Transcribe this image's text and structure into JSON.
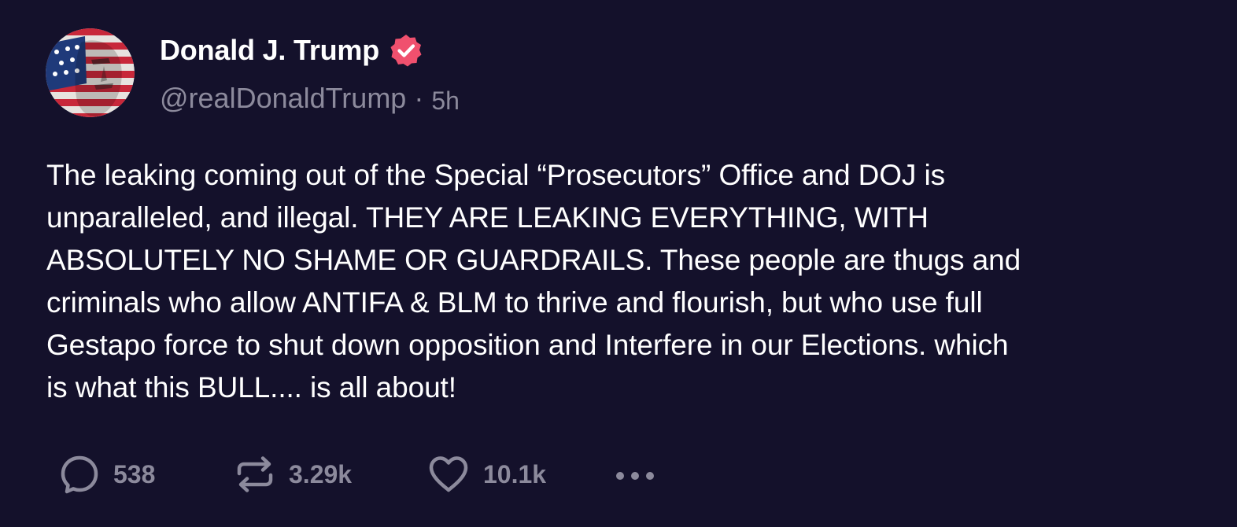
{
  "author": {
    "display_name": "Donald J. Trump",
    "handle": "@realDonaldTrump",
    "separator": "·",
    "time_ago": "5h",
    "verified_icon": "verified-badge-icon",
    "verified_color": "#f0506e",
    "avatar_icon": "profile-avatar"
  },
  "post": {
    "text": "The leaking coming out of the Special “Prosecutors” Office and DOJ is\nunparalleled, and illegal. THEY ARE LEAKING EVERYTHING, WITH\nABSOLUTELY NO SHAME OR GUARDRAILS. These people are thugs and\ncriminals who allow ANTIFA & BLM to thrive and flourish, but who use full\nGestapo force to shut down opposition and Interfere in our Elections. which\nis what this BULL.... is all about!"
  },
  "actions": {
    "replies": {
      "icon": "reply-icon",
      "count": "538"
    },
    "reposts": {
      "icon": "repost-icon",
      "count": "3.29k"
    },
    "likes": {
      "icon": "heart-icon",
      "count": "10.1k"
    },
    "more": {
      "icon": "more-icon"
    }
  },
  "colors": {
    "background": "#14112b",
    "primary_text": "#ffffff",
    "secondary_text": "#8c8a9c",
    "accent": "#f0506e"
  }
}
